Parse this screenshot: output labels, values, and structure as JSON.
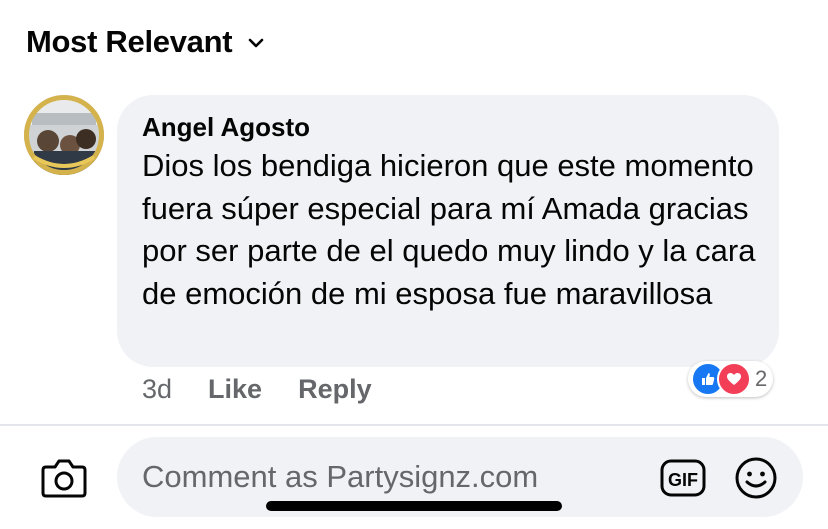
{
  "sort": {
    "label": "Most Relevant"
  },
  "comment": {
    "author": "Angel Agosto",
    "text": "Dios los bendiga hicieron que este momento fuera súper especial para mí Amada gracias por ser parte de el quedo muy lindo y la cara de emoción de mi esposa fue maravillosa",
    "time": "3d",
    "like_label": "Like",
    "reply_label": "Reply",
    "reactions": {
      "icons": [
        "like-icon",
        "love-icon"
      ],
      "count": "2"
    }
  },
  "composer": {
    "placeholder": "Comment as Partysignz.com"
  },
  "colors": {
    "like": "#1877f2",
    "love": "#f33e58",
    "bubble": "#f0f2f5",
    "secondary_text": "#65676b"
  }
}
